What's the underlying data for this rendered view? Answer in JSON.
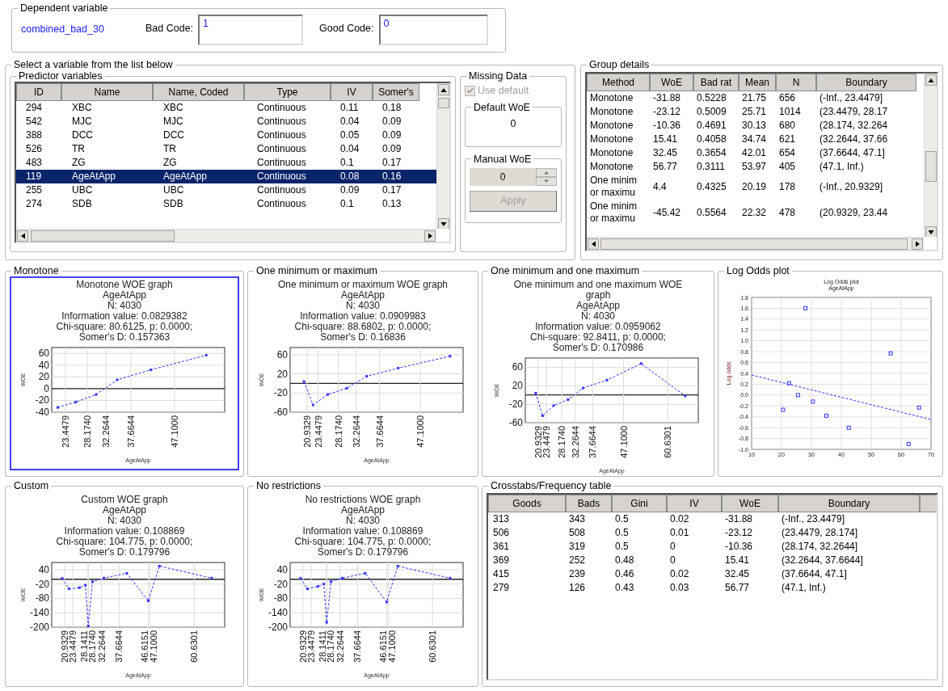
{
  "dependent_variable": {
    "legend": "Dependent variable",
    "value": "combined_bad_30",
    "bad_code": {
      "label": "Bad Code:",
      "value": "1"
    },
    "good_code": {
      "label": "Good Code:",
      "value": "0"
    }
  },
  "select_group": {
    "legend": "Select a variable from the list below"
  },
  "predictors": {
    "legend": "Predictor variables",
    "columns": [
      "ID",
      "Name",
      "Name, Coded",
      "Type",
      "IV",
      "Somer's"
    ],
    "rows": [
      {
        "cells": [
          "294",
          "XBC",
          "XBC",
          "Continuous",
          "0.11",
          "0.18"
        ],
        "selected": false
      },
      {
        "cells": [
          "542",
          "MJC",
          "MJC",
          "Continuous",
          "0.04",
          "0.09"
        ],
        "selected": false
      },
      {
        "cells": [
          "388",
          "DCC",
          "DCC",
          "Continuous",
          "0.05",
          "0.09"
        ],
        "selected": false
      },
      {
        "cells": [
          "526",
          "TR",
          "TR",
          "Continuous",
          "0.04",
          "0.09"
        ],
        "selected": false
      },
      {
        "cells": [
          "483",
          "ZG",
          "ZG",
          "Continuous",
          "0.1",
          "0.17"
        ],
        "selected": false
      },
      {
        "cells": [
          "119",
          "AgeAtApp",
          "AgeAtApp",
          "Continuous",
          "0.08",
          "0.16"
        ],
        "selected": true
      },
      {
        "cells": [
          "255",
          "UBC",
          "UBC",
          "Continuous",
          "0.09",
          "0.17"
        ],
        "selected": false
      },
      {
        "cells": [
          "274",
          "SDB",
          "SDB",
          "Continuous",
          "0.1",
          "0.13"
        ],
        "selected": false
      }
    ]
  },
  "missing_data": {
    "legend": "Missing Data",
    "use_default": {
      "label": "Use default",
      "checked": true,
      "disabled": true
    },
    "default_woe": {
      "legend": "Default WoE",
      "value": "0"
    },
    "manual_woe": {
      "legend": "Manual WoE",
      "value": "0",
      "disabled": true
    },
    "apply": {
      "label": "Apply",
      "disabled": true
    }
  },
  "group_details": {
    "legend": "Group details",
    "columns": [
      "Method",
      "WoE",
      "Bad rat",
      "Mean",
      "N",
      "Boundary"
    ],
    "rows": [
      [
        "Monotone",
        "-31.88",
        "0.5228",
        "21.75",
        "656",
        "(-Inf., 23.4479]"
      ],
      [
        "Monotone",
        "-23.12",
        "0.5009",
        "25.71",
        "1014",
        "(23.4479, 28.17"
      ],
      [
        "Monotone",
        "-10.36",
        "0.4691",
        "30.13",
        "680",
        "(28.174, 32.264"
      ],
      [
        "Monotone",
        "15.41",
        "0.4058",
        "34.74",
        "621",
        "(32.2644, 37.66"
      ],
      [
        "Monotone",
        "32.45",
        "0.3654",
        "42.01",
        "654",
        "(37.6644, 47.1]"
      ],
      [
        "Monotone",
        "56.77",
        "0.3111",
        "53.97",
        "405",
        "(47.1, Inf.)"
      ],
      [
        "One minim or maximu",
        "4.4",
        "0.4325",
        "20.19",
        "178",
        "(-Inf., 20.9329]"
      ],
      [
        "One minim or maximu",
        "-45.42",
        "0.5564",
        "22.32",
        "478",
        "(20.9329, 23.44"
      ]
    ]
  },
  "graphs": [
    {
      "legend": "Monotone",
      "selected": true,
      "caption": [
        "Monotone WOE graph",
        "AgeAtApp",
        "N: 4030",
        "Information value:  0.0829382",
        "Chi-square:  80.6125, p:  0.0000;",
        "Somer's D:  0.157363"
      ],
      "chart_data": {
        "type": "line",
        "xlabel": "AgeAtApp",
        "ylabel": "WOE",
        "grid": true,
        "x": [
          21.8,
          25.7,
          30.1,
          34.7,
          42,
          54
        ],
        "series": [
          {
            "color": "#3333ff",
            "line_style": "dashed",
            "marker": "square",
            "values": [
              -32,
              -23,
              -10,
              15,
              32,
              57
            ]
          }
        ],
        "xlim": [
          20.5,
          58
        ],
        "ylim": [
          -40,
          70
        ],
        "xticks": [
          {
            "value": 23.4479,
            "label": "23.4479"
          },
          {
            "value": 28.174,
            "label": "28.1740"
          },
          {
            "value": 32.2644,
            "label": "32.2644"
          },
          {
            "value": 37.6644,
            "label": "37.6644"
          },
          {
            "value": 47.1,
            "label": "47.1000"
          }
        ],
        "yticks": [
          60,
          40,
          20,
          0,
          -20,
          -40
        ]
      }
    },
    {
      "legend": "One minimum or maximum",
      "selected": false,
      "caption": [
        "One minimum or maximum WOE graph",
        "AgeAtApp",
        "N: 4030",
        "Information value:  0.0909983",
        "Chi-square:  88.6802, p:  0.0000;",
        "Somer's D:  0.16836"
      ],
      "chart_data": {
        "type": "line",
        "xlabel": "AgeAtApp",
        "ylabel": "WOE",
        "grid": true,
        "x": [
          20.2,
          22.3,
          25.7,
          30.1,
          34.7,
          42,
          54
        ],
        "series": [
          {
            "color": "#3333ff",
            "line_style": "dashed",
            "marker": "square",
            "values": [
              4,
              -45,
              -23,
              -10,
              15,
              32,
              57
            ]
          }
        ],
        "xlim": [
          17,
          57
        ],
        "ylim": [
          -60,
          75
        ],
        "xticks": [
          {
            "value": 20.9329,
            "label": "20.9329"
          },
          {
            "value": 23.4479,
            "label": "23.4479"
          },
          {
            "value": 28.174,
            "label": "28.1740"
          },
          {
            "value": 32.2644,
            "label": "32.2644"
          },
          {
            "value": 37.6644,
            "label": "37.6644"
          },
          {
            "value": 47.1,
            "label": "47.1000"
          }
        ],
        "yticks": [
          60,
          20,
          -20,
          -60
        ]
      }
    },
    {
      "legend": "One minimum and one maximum",
      "selected": false,
      "caption": [
        "One minimum and one maximum WOE graph",
        "AgeAtApp",
        "N: 4030",
        "Information value:  0.0959062",
        "Chi-square:  92.8411, p:  0.0000;",
        "Somer's D:  0.170986"
      ],
      "chart_data": {
        "type": "line",
        "xlabel": "AgeAtApp",
        "ylabel": "WOE",
        "grid": true,
        "x": [
          20.2,
          22.3,
          25.7,
          30.1,
          34.7,
          42,
          52.5,
          66
        ],
        "series": [
          {
            "color": "#3333ff",
            "line_style": "dashed",
            "marker": "square",
            "values": [
              4,
              -45,
              -23,
              -10,
              15,
              32,
              68,
              -2
            ]
          }
        ],
        "xlim": [
          17,
          70
        ],
        "ylim": [
          -60,
          80
        ],
        "xticks": [
          {
            "value": 20.9329,
            "label": "20.9329"
          },
          {
            "value": 23.4479,
            "label": "23.4479"
          },
          {
            "value": 28.174,
            "label": "28.1740"
          },
          {
            "value": 32.2644,
            "label": "32.2644"
          },
          {
            "value": 37.6644,
            "label": "37.6644"
          },
          {
            "value": 47.1,
            "label": "47.1000"
          },
          {
            "value": 60.6301,
            "label": "60.6301"
          }
        ],
        "yticks": [
          60,
          20,
          -20,
          -60
        ]
      }
    },
    {
      "legend": "Custom",
      "selected": false,
      "caption": [
        "Custom WOE graph",
        "AgeAtApp",
        "N: 4030",
        "Information value:  0.108869",
        "Chi-square:  104.775, p:  0.0000;",
        "Somer's D:  0.179796"
      ],
      "chart_data": {
        "type": "line",
        "xlabel": "AgeAtApp",
        "ylabel": "WOE",
        "grid": true,
        "x": [
          20.2,
          22.3,
          25.5,
          27.3,
          28.2,
          29.5,
          33,
          40,
          46.6,
          50,
          66
        ],
        "series": [
          {
            "color": "#3333ff",
            "line_style": "dashed",
            "marker": "square",
            "values": [
              4,
              -40,
              -35,
              -25,
              -195,
              -10,
              5,
              25,
              -90,
              55,
              5
            ]
          }
        ],
        "xlim": [
          17,
          70
        ],
        "ylim": [
          -200,
          70
        ],
        "xticks": [
          {
            "value": 20.9329,
            "label": "20.9329"
          },
          {
            "value": 23.4479,
            "label": "23.4479"
          },
          {
            "value": 28.1411,
            "label": "28.1411"
          },
          {
            "value": 28.174,
            "label": "28.1740"
          },
          {
            "value": 32.2644,
            "label": "32.2644"
          },
          {
            "value": 37.6644,
            "label": "37.6644"
          },
          {
            "value": 46.6151,
            "label": "46.6151"
          },
          {
            "value": 47.1,
            "label": "47.1000"
          },
          {
            "value": 60.6301,
            "label": "60.6301"
          }
        ],
        "yticks": [
          40,
          -20,
          -80,
          -140,
          -200
        ]
      }
    },
    {
      "legend": "No restrictions",
      "selected": false,
      "caption": [
        "No restrictions WOE graph",
        "AgeAtApp",
        "N: 4030",
        "Information value:  0.108869",
        "Chi-square:  104.775, p:  0.0000;",
        "Somer's D:  0.179796"
      ],
      "chart_data": {
        "type": "line",
        "xlabel": "AgeAtApp",
        "ylabel": "WOE",
        "grid": true,
        "x": [
          20.2,
          22.3,
          25.5,
          27.3,
          28.2,
          29.5,
          33,
          40,
          46.6,
          50,
          66
        ],
        "series": [
          {
            "color": "#3333ff",
            "line_style": "dashed",
            "marker": "square",
            "values": [
              4,
              -40,
              -30,
              -20,
              -180,
              -10,
              5,
              25,
              -95,
              55,
              5
            ]
          }
        ],
        "xlim": [
          17,
          70
        ],
        "ylim": [
          -200,
          70
        ],
        "xticks": [
          {
            "value": 20.9329,
            "label": "20.9329"
          },
          {
            "value": 23.4479,
            "label": "23.4479"
          },
          {
            "value": 28.1411,
            "label": "28.1411"
          },
          {
            "value": 28.174,
            "label": "28.1740"
          },
          {
            "value": 32.2644,
            "label": "32.2644"
          },
          {
            "value": 37.6644,
            "label": "37.6644"
          },
          {
            "value": 46.6151,
            "label": "46.6151"
          },
          {
            "value": 47.1,
            "label": "47.1000"
          },
          {
            "value": 60.6301,
            "label": "60.6301"
          }
        ],
        "yticks": [
          40,
          -20,
          -80,
          -140,
          -200
        ]
      }
    }
  ],
  "log_odds": {
    "legend": "Log Odds plot",
    "chart_data": {
      "type": "scatter",
      "title": "Log Odds plot",
      "subtitle": "AgeAtApp",
      "ylabel": "Log odds",
      "grid": true,
      "x": [
        10,
        20.5,
        22.5,
        25.5,
        28,
        30.5,
        35,
        42.5,
        56.5,
        62.5,
        66,
        70
      ],
      "series": [
        {
          "color": "#3333ff",
          "marker": "square",
          "values": [
            null,
            -0.27,
            0.22,
            0,
            1.6,
            -0.12,
            -0.38,
            -0.6,
            0.77,
            -0.9,
            -0.23,
            null
          ]
        },
        {
          "type": "line",
          "color": "#3333ff",
          "line_style": "dashed",
          "values": [
            0.37,
            null,
            null,
            null,
            null,
            null,
            null,
            null,
            null,
            null,
            null,
            -0.45
          ]
        }
      ],
      "xlim": [
        10,
        70
      ],
      "ylim": [
        -1,
        1.8
      ],
      "xticks": [
        10,
        20,
        30,
        40,
        50,
        60,
        70
      ],
      "yticks": [
        {
          "value": 1.8,
          "label": "1.8"
        },
        {
          "value": 1.6,
          "label": "1.6"
        },
        {
          "value": 1.4,
          "label": "1.4"
        },
        {
          "value": 1.2,
          "label": "1.2"
        },
        {
          "value": 1,
          "label": "1.0"
        },
        {
          "value": 0.8,
          "label": "0.8"
        },
        {
          "value": 0.6,
          "label": "0.6"
        },
        {
          "value": 0.4,
          "label": "0.4"
        },
        {
          "value": 0.2,
          "label": "0.2"
        },
        {
          "value": 0,
          "label": "0.0"
        },
        {
          "value": -0.2,
          "label": "-0.2"
        },
        {
          "value": -0.4,
          "label": "-0.4"
        },
        {
          "value": -0.6,
          "label": "-0.6"
        },
        {
          "value": -0.8,
          "label": "-0.8"
        },
        {
          "value": -1,
          "label": "-1.0"
        }
      ]
    }
  },
  "crosstabs": {
    "legend": "Crosstabs/Frequency table",
    "columns": [
      "Goods",
      "Bads",
      "Gini",
      "IV",
      "WoE",
      "Boundary"
    ],
    "rows": [
      [
        "313",
        "343",
        "0.5",
        "0.02",
        "-31.88",
        "(-Inf., 23.4479]"
      ],
      [
        "506",
        "508",
        "0.5",
        "0.01",
        "-23.12",
        "(23.4479, 28.174]"
      ],
      [
        "361",
        "319",
        "0.5",
        "0",
        "-10.36",
        "(28.174, 32.2644]"
      ],
      [
        "369",
        "252",
        "0.48",
        "0",
        "15.41",
        "(32.2644, 37.6644]"
      ],
      [
        "415",
        "239",
        "0.46",
        "0.02",
        "32.45",
        "(37.6644, 47.1]"
      ],
      [
        "279",
        "126",
        "0.43",
        "0.03",
        "56.77",
        "(47.1, Inf.)"
      ]
    ]
  }
}
